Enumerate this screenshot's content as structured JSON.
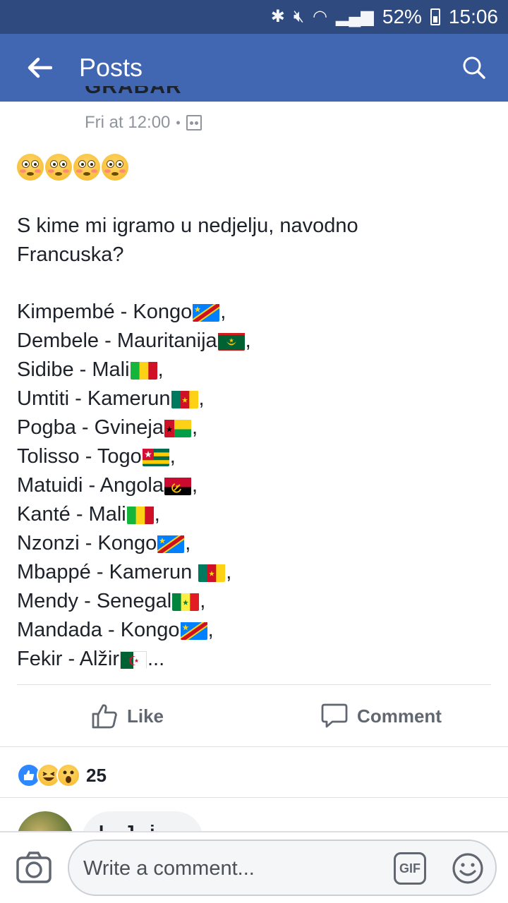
{
  "status_bar": {
    "battery": "52%",
    "time": "15:06"
  },
  "app_bar": {
    "title": "Posts"
  },
  "post": {
    "author_cut": "GRABAR",
    "timestamp": "Fri at 12:00",
    "meta_separator": "•",
    "question": "S kime mi igramo u nedjelju, navodno Francuska?",
    "players": [
      {
        "text": "Kimpembé - Kongo",
        "flag": "cd",
        "space_before_flag": false,
        "suffix": ","
      },
      {
        "text": "Dembele - Mauritanija",
        "flag": "mr",
        "space_before_flag": false,
        "suffix": ","
      },
      {
        "text": "Sidibe - Mali",
        "flag": "ml",
        "space_before_flag": false,
        "suffix": ","
      },
      {
        "text": "Umtiti - Kamerun",
        "flag": "cm",
        "space_before_flag": false,
        "suffix": ","
      },
      {
        "text": "Pogba - Gvineja",
        "flag": "gw",
        "space_before_flag": false,
        "suffix": ","
      },
      {
        "text": "Tolisso - Togo",
        "flag": "tg",
        "space_before_flag": false,
        "suffix": ","
      },
      {
        "text": "Matuidi - Angola",
        "flag": "ao",
        "space_before_flag": false,
        "suffix": ","
      },
      {
        "text": "Kanté - Mali",
        "flag": "ml",
        "space_before_flag": false,
        "suffix": ","
      },
      {
        "text": "Nzonzi - Kongo",
        "flag": "cd",
        "space_before_flag": false,
        "suffix": ","
      },
      {
        "text": "Mbappé - Kamerun",
        "flag": "cm",
        "space_before_flag": true,
        "suffix": ","
      },
      {
        "text": "Mendy - Senegal",
        "flag": "sn",
        "space_before_flag": false,
        "suffix": ","
      },
      {
        "text": "Mandada - Kongo",
        "flag": "cd",
        "space_before_flag": false,
        "suffix": ","
      },
      {
        "text": "Fekir - Alžir",
        "flag": "dz",
        "space_before_flag": false,
        "suffix": "..."
      }
    ]
  },
  "actions": {
    "like_label": "Like",
    "comment_label": "Comment"
  },
  "reactions": {
    "count": "25",
    "types": [
      "like",
      "haha",
      "wow"
    ]
  },
  "comment_preview": {
    "author_cut": "I... J...i..."
  },
  "composer": {
    "placeholder": "Write a comment...",
    "gif_label": "GIF"
  },
  "colors": {
    "brand": "#4267b2",
    "status_bar": "#2e4a7f",
    "like_blue": "#2d88ff"
  }
}
